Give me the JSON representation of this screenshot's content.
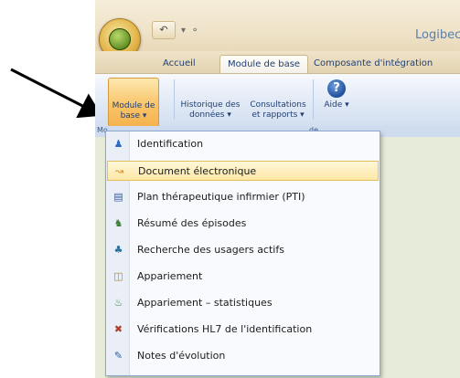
{
  "window": {
    "title": "Logibec"
  },
  "quick_access": {
    "undo_glyph": "↶",
    "dropdown_glyph": "▾",
    "more_glyph": "⚬"
  },
  "tabs": [
    {
      "label": "Accueil"
    },
    {
      "label": "Module de base"
    },
    {
      "label": "Composante d'intégration"
    }
  ],
  "ribbon": {
    "buttons": [
      {
        "label": "Module de base ▾"
      },
      {
        "label": "Historique des données ▾"
      },
      {
        "label": "Consultations et rapports ▾"
      },
      {
        "label": "Aide ▾"
      }
    ],
    "help_glyph": "?"
  },
  "group_labels": {
    "left": "Mo",
    "right": "de"
  },
  "menu": {
    "items": [
      {
        "label": "Identification",
        "icon": "person-icon",
        "glyph": "♟",
        "color": "#2a6cc4"
      },
      {
        "label": "Document électronique",
        "icon": "stethoscope-icon",
        "glyph": "↝",
        "color": "#d28a2b"
      },
      {
        "label": "Plan thérapeutique infirmier (PTI)",
        "icon": "document-icon",
        "glyph": "▤",
        "color": "#2e5fa8"
      },
      {
        "label": "Résumé des épisodes",
        "icon": "episodes-icon",
        "glyph": "♞",
        "color": "#3f7f3a"
      },
      {
        "label": "Recherche des usagers actifs",
        "icon": "search-users-icon",
        "glyph": "♣",
        "color": "#2c6e9c"
      },
      {
        "label": "Appariement",
        "icon": "match-icon",
        "glyph": "◫",
        "color": "#b08a1d"
      },
      {
        "label": "Appariement – statistiques",
        "icon": "statistics-icon",
        "glyph": "♨",
        "color": "#3a8e4a"
      },
      {
        "label": "Vérifications HL7 de l'identification",
        "icon": "hl7-check-icon",
        "glyph": "✖",
        "color": "#b23c2a"
      },
      {
        "label": "Notes d'évolution",
        "icon": "notes-icon",
        "glyph": "✎",
        "color": "#2d5f9f"
      }
    ],
    "highlighted": "Document électronique"
  },
  "colors": {
    "accent": "#f9c56a",
    "menu_border": "#8ea7cd",
    "arrow": "#000000"
  }
}
